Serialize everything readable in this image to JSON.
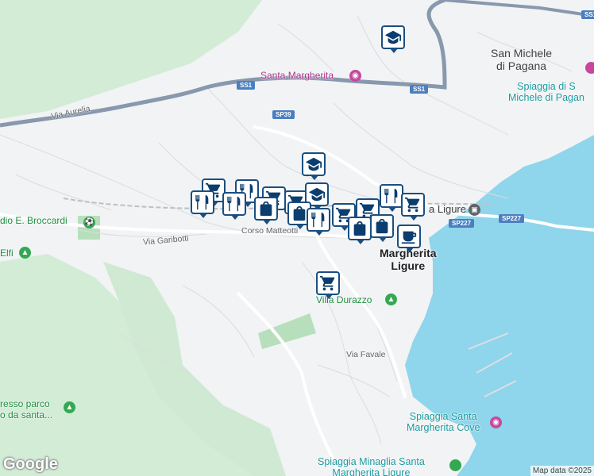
{
  "colors": {
    "sea": "#8fd5eb",
    "land": "#f1f3f4",
    "park": "#c7e8c9",
    "road": "#ffffff",
    "highway": "#8898ad",
    "marker_border": "#1a4e80",
    "marker_icon": "#0b3d6e"
  },
  "labels": {
    "san_michele": "San Michele\ndi Pagana",
    "santa_margherita_ligure": "Santa Margherita Ligure",
    "santa_margherita_ligure_top": "Santa Margherita",
    "santa_margherita_poi": "Santa Margherita",
    "villa_durazzo": "Villa Durazzo",
    "via_aurelia": "Via Aurelia",
    "via_garibotti": "Via Garibotti",
    "corso_matteotti": "Corso Matteotti",
    "via_favale": "Via Favale",
    "stadio": "dio E. Broccardi",
    "elfi": "Elfi",
    "spiaggia_san_michele": "Spiaggia di S\nMichele di Pagan",
    "spiaggia_cove": "Spiaggia Santa\nMargherita Cove",
    "spiaggia_minaglia": "Spiaggia Minaglia Santa\nMargherita Ligure",
    "ingresso": "resso parco\no da santa...",
    "station": "a Ligure",
    "city_center": "Margherita\nLigure",
    "city_center_top": "a"
  },
  "shields": {
    "ss1_a": "SS1",
    "ss1_b": "SS1",
    "ss1_c": "SS1",
    "sp39": "SP39",
    "sp227_a": "SP227",
    "sp227_b": "SP227"
  },
  "attribution": {
    "google": "Google",
    "map_data": "Map data ©2025"
  },
  "icons": {
    "education": "graduation-cap-icon",
    "food": "fork-knife-icon",
    "cart": "shopping-cart-icon",
    "bag": "shopping-bag-icon",
    "cafe": "coffee-cup-icon"
  }
}
